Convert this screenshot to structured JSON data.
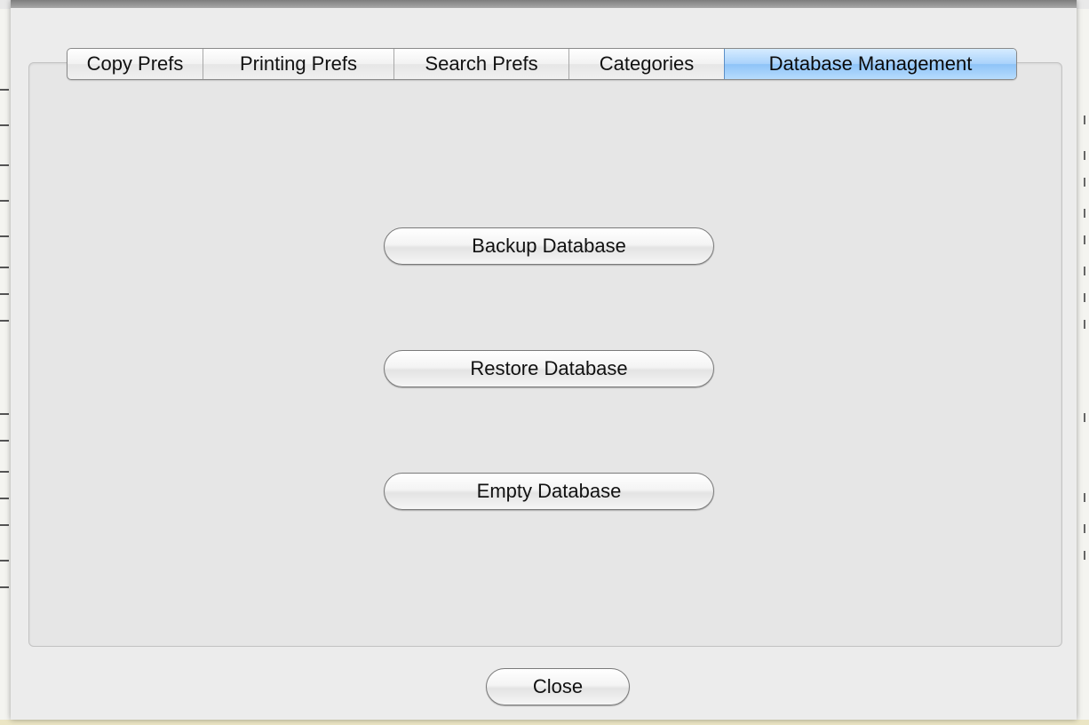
{
  "tabs": [
    {
      "label": "Copy Prefs",
      "active": false
    },
    {
      "label": "Printing Prefs",
      "active": false
    },
    {
      "label": "Search Prefs",
      "active": false
    },
    {
      "label": "Categories",
      "active": false
    },
    {
      "label": "Database Management",
      "active": true
    }
  ],
  "database": {
    "backup_label": "Backup Database",
    "restore_label": "Restore Database",
    "empty_label": "Empty Database"
  },
  "footer": {
    "close_label": "Close"
  },
  "colors": {
    "active_tab": "#a9d2fb",
    "panel_background": "#e6e6e6",
    "sheet_background": "#ececec"
  }
}
